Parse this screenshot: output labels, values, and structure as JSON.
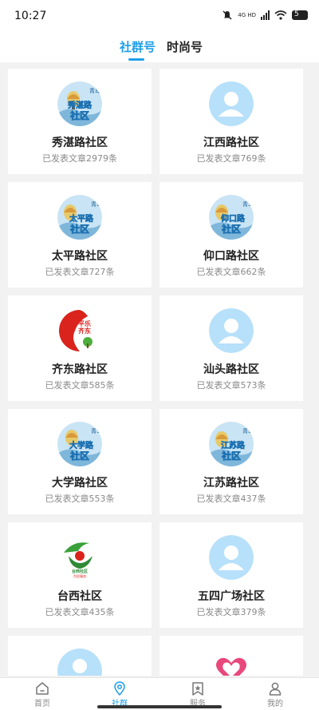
{
  "status_bar": {
    "time": "10:27",
    "network": "4G HD",
    "battery": "5"
  },
  "tabs": [
    {
      "label": "社群号",
      "active": true
    },
    {
      "label": "时尚号",
      "active": false
    }
  ],
  "communities": [
    {
      "name": "秀湛路社区",
      "posts": "已发表文章2979条",
      "avatar": "balloon-logo",
      "badge": "秀湛路社区"
    },
    {
      "name": "江西路社区",
      "posts": "已发表文章769条",
      "avatar": "default-avatar"
    },
    {
      "name": "太平路社区",
      "posts": "已发表文章727条",
      "avatar": "balloon-logo",
      "badge": "太平路社区"
    },
    {
      "name": "仰口路社区",
      "posts": "已发表文章662条",
      "avatar": "balloon-logo",
      "badge": "仰口路社区"
    },
    {
      "name": "齐东路社区",
      "posts": "已发表文章585条",
      "avatar": "red-logo"
    },
    {
      "name": "汕头路社区",
      "posts": "已发表文章573条",
      "avatar": "default-avatar"
    },
    {
      "name": "大学路社区",
      "posts": "已发表文章553条",
      "avatar": "balloon-logo",
      "badge": "大学路社区"
    },
    {
      "name": "江苏路社区",
      "posts": "已发表文章437条",
      "avatar": "balloon-logo",
      "badge": "江苏路社区"
    },
    {
      "name": "台西社区",
      "posts": "已发表文章435条",
      "avatar": "taixi-logo"
    },
    {
      "name": "五四广场社区",
      "posts": "已发表文章379条",
      "avatar": "default-avatar"
    },
    {
      "name": "",
      "posts": "",
      "avatar": "default-avatar"
    },
    {
      "name": "",
      "posts": "",
      "avatar": "pink-heart-logo"
    }
  ],
  "bottom_nav": [
    {
      "label": "首页",
      "icon": "home-icon",
      "active": false
    },
    {
      "label": "社群",
      "icon": "location-pin-icon",
      "active": true
    },
    {
      "label": "服务",
      "icon": "star-bookmark-icon",
      "active": false
    },
    {
      "label": "我的",
      "icon": "person-icon",
      "active": false
    }
  ],
  "colors": {
    "accent": "#1e9ee8",
    "avatar_bg": "#b7e0fa",
    "background": "#f2f2f2"
  }
}
